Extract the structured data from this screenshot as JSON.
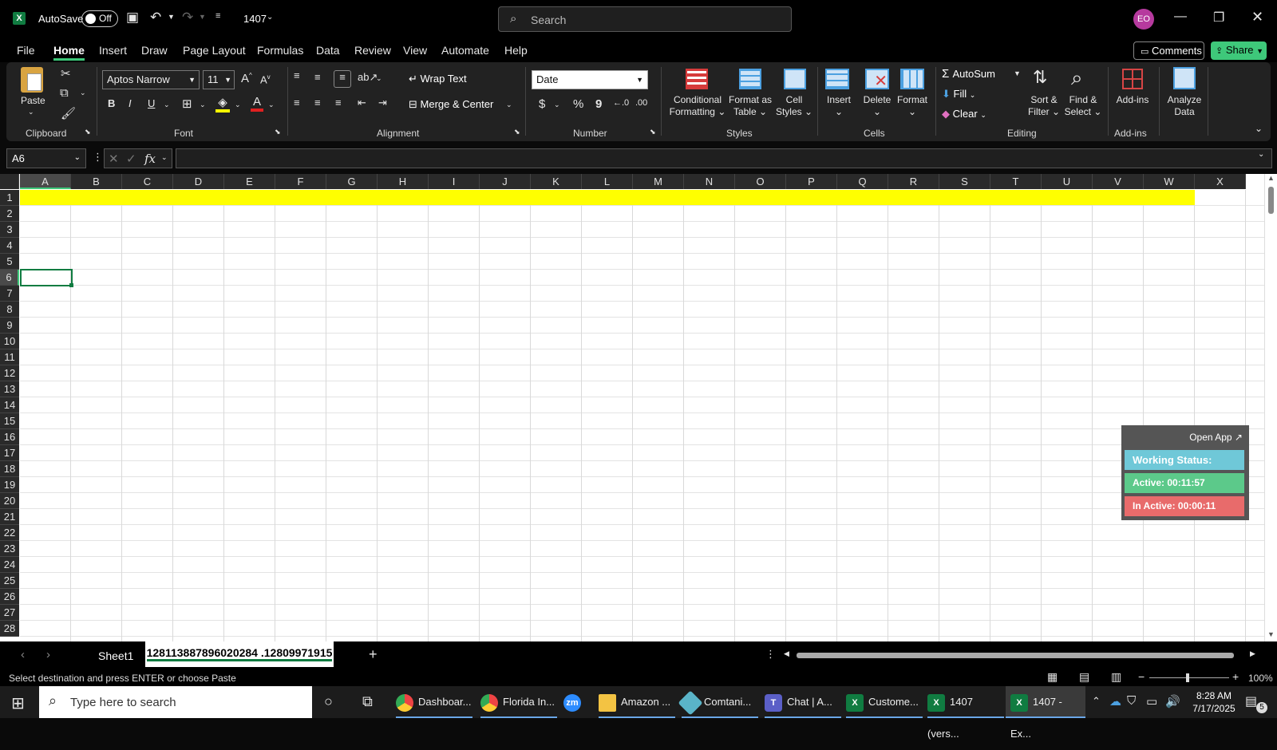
{
  "title": {
    "autosave_label": "AutoSave",
    "toggle_state": "Off",
    "filename": "1407",
    "search_placeholder": "Search",
    "avatar": "EO"
  },
  "menu": [
    "File",
    "Home",
    "Insert",
    "Draw",
    "Page Layout",
    "Formulas",
    "Data",
    "Review",
    "View",
    "Automate",
    "Help"
  ],
  "menu_right": {
    "comments": "Comments",
    "share": "Share"
  },
  "ribbon": {
    "paste": "Paste",
    "font_name": "Aptos Narrow",
    "font_size": "11",
    "bold": "B",
    "italic": "I",
    "underline": "U",
    "wrap_text": "Wrap Text",
    "merge_center": "Merge & Center",
    "number_format": "Date",
    "currency": "$",
    "percent": "%",
    "comma": "9",
    "cond_format": "Conditional",
    "cond_format2": "Formatting",
    "format_table": "Format as",
    "format_table2": "Table",
    "cell_styles": "Cell",
    "cell_styles2": "Styles",
    "insert": "Insert",
    "delete": "Delete",
    "format": "Format",
    "autosum": "AutoSum",
    "fill": "Fill",
    "clear": "Clear",
    "sort_filter": "Sort &",
    "sort_filter2": "Filter",
    "find_select": "Find &",
    "find_select2": "Select",
    "addins": "Add-ins",
    "analyze": "Analyze",
    "analyze2": "Data",
    "groups": {
      "clipboard": "Clipboard",
      "font": "Font",
      "alignment": "Alignment",
      "number": "Number",
      "styles": "Styles",
      "cells": "Cells",
      "editing": "Editing",
      "addins": "Add-ins"
    }
  },
  "formula_bar": {
    "name_box": "A6",
    "fx": "fx"
  },
  "columns": [
    "A",
    "B",
    "C",
    "D",
    "E",
    "F",
    "G",
    "H",
    "I",
    "J",
    "K",
    "L",
    "M",
    "N",
    "O",
    "P",
    "Q",
    "R",
    "S",
    "T",
    "U",
    "V",
    "W",
    "X"
  ],
  "rows": [
    "1",
    "2",
    "3",
    "4",
    "5",
    "6",
    "7",
    "8",
    "9",
    "10",
    "11",
    "12",
    "13",
    "14",
    "15",
    "16",
    "17",
    "18",
    "19",
    "20",
    "21",
    "22",
    "23",
    "24",
    "25",
    "26",
    "27",
    "28"
  ],
  "sheets": [
    "Sheet1",
    "128113887896020284 .12809971915"
  ],
  "status": {
    "message": "Select destination and press ENTER or choose Paste",
    "zoom": "100%"
  },
  "panel": {
    "open_app": "Open App ↗",
    "working": "Working Status: Active",
    "active": "Active: 00:11:57",
    "inactive": "In Active: 00:00:11"
  },
  "taskbar": {
    "search": "Type here to search",
    "apps": [
      "Dashboar...",
      "Florida In...",
      "",
      "Amazon ...",
      "Comtani...",
      "Chat | A...",
      "Custome...",
      "1407 (vers...",
      "1407 - Ex..."
    ],
    "time": "8:28 AM",
    "date": "7/17/2025",
    "notif": "5"
  },
  "colors": {
    "yellow": "#ffff00",
    "excel_green": "#107c41",
    "status_active": "#6fc8d8",
    "active_green": "#5cc98a",
    "inactive_red": "#e86b6b"
  }
}
